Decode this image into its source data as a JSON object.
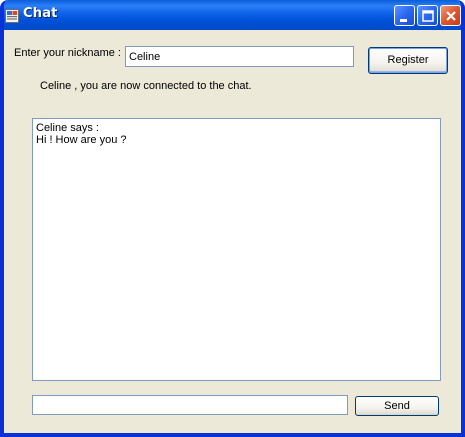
{
  "window": {
    "title": "Chat"
  },
  "form": {
    "nickname_label": "Enter your nickname :",
    "nickname_value": "Celine",
    "register_label": "Register",
    "status_text": "Celine , you are now connected to the chat.",
    "messages": [
      "Celine says :",
      "Hi ! How are you ?"
    ],
    "message_value": "",
    "send_label": "Send"
  },
  "colors": {
    "window_bg": "#ece9d8",
    "titlebar_blue": "#0051d6",
    "textbox_border": "#7f9db9",
    "close_red": "#e0552f"
  },
  "icons": {
    "app": "chat-app-icon",
    "minimize": "minimize-icon",
    "maximize": "maximize-icon",
    "close": "close-icon"
  }
}
